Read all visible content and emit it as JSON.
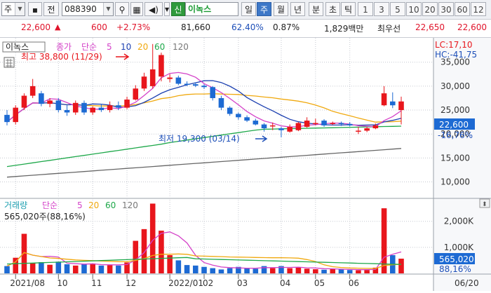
{
  "toolbar": {
    "market": "주",
    "prev_label": "전",
    "code": "088390",
    "signal_badge": "신",
    "stock_name": "이녹스",
    "periods": [
      "일",
      "주",
      "월",
      "년",
      "분",
      "초",
      "틱"
    ],
    "selected_period": "주",
    "intervals": [
      "1",
      "3",
      "5",
      "10",
      "20",
      "30",
      "60",
      "12"
    ]
  },
  "price_row": {
    "price": "22,600",
    "change": "600",
    "change_pct": "+2.73%",
    "volume": "81,660",
    "pct1": "62.40%",
    "pct2": "0.87%",
    "amount": "1,829백만",
    "quote_label": "최우선",
    "ask": "22,650",
    "bid": "22,600"
  },
  "legend": {
    "name": "이녹스",
    "price_label": "종가",
    "ma_label": "단순",
    "ma_periods": [
      "5",
      "10",
      "20",
      "60",
      "120"
    ]
  },
  "volume_legend": {
    "name": "거래량",
    "ma_label": "단순",
    "ma_periods": [
      "5",
      "20",
      "60",
      "120"
    ],
    "current": "565,020주(88,16%)"
  },
  "annotations": {
    "high": "최고 38,800 (11/29)",
    "low": "최저 19,300 (03/14)"
  },
  "right_axis": {
    "lc": "LC:17,10",
    "hc": "HC:-41,75",
    "price_ticks": [
      "35,000",
      "30,000",
      "25,000",
      "20,000",
      "15,000",
      "10,000"
    ],
    "current_price": "22,600",
    "current_pct": "-16,76%",
    "volume_ticks": [
      "2,000K",
      "1,000K"
    ],
    "current_volume": "565,020",
    "current_volume_pct": "88,16%"
  },
  "x_axis": [
    "2021/08",
    "10",
    "11",
    "12",
    "2022/01",
    "02",
    "03",
    "04",
    "05",
    "06",
    "06/20"
  ],
  "colors": {
    "up": "#e8161c",
    "down": "#1d6ad3",
    "ma5": "#d442c8",
    "ma10": "#1b3fb0",
    "ma20": "#f0a90f",
    "ma60": "#1ea84a",
    "ma120": "#666666"
  },
  "chart_data": {
    "type": "candlestick",
    "x": [
      "2021-07-26",
      "2021-08-02",
      "2021-08-09",
      "2021-08-16",
      "2021-08-23",
      "2021-08-30",
      "2021-09-06",
      "2021-09-13",
      "2021-09-20",
      "2021-09-27",
      "2021-10-04",
      "2021-10-11",
      "2021-10-18",
      "2021-10-25",
      "2021-11-01",
      "2021-11-08",
      "2021-11-15",
      "2021-11-22",
      "2021-11-29",
      "2021-12-06",
      "2021-12-13",
      "2021-12-20",
      "2021-12-27",
      "2022-01-03",
      "2022-01-10",
      "2022-01-17",
      "2022-01-24",
      "2022-02-07",
      "2022-02-14",
      "2022-02-21",
      "2022-02-28",
      "2022-03-07",
      "2022-03-14",
      "2022-03-21",
      "2022-03-28",
      "2022-04-04",
      "2022-04-11",
      "2022-04-18",
      "2022-04-25",
      "2022-05-02",
      "2022-05-09",
      "2022-05-16",
      "2022-05-23",
      "2022-05-30",
      "2022-06-06",
      "2022-06-13",
      "2022-06-20"
    ],
    "open": [
      24000,
      22500,
      25500,
      28000,
      28500,
      26300,
      27000,
      25000,
      24500,
      26500,
      24500,
      25500,
      25000,
      26000,
      25500,
      27200,
      29500,
      30000,
      32000,
      31500,
      31800,
      30500,
      30400,
      30100,
      29800,
      27500,
      25500,
      24200,
      23500,
      22800,
      22000,
      21800,
      21200,
      20500,
      20800,
      21500,
      22300,
      22800,
      22300,
      22300,
      22100,
      20500,
      20700,
      21200,
      26000,
      26800,
      25000
    ],
    "close": [
      22500,
      25500,
      28000,
      30000,
      26300,
      27000,
      25000,
      24500,
      26500,
      24500,
      25500,
      25000,
      26000,
      25500,
      27200,
      29500,
      32000,
      33500,
      36500,
      31800,
      30500,
      30400,
      30100,
      29800,
      27500,
      25500,
      24200,
      23500,
      22800,
      22000,
      21200,
      21800,
      20800,
      21500,
      22300,
      22800,
      22300,
      21800,
      22300,
      22100,
      21800,
      20700,
      21200,
      21800,
      28500,
      26000,
      26800
    ],
    "high": [
      25000,
      26000,
      28500,
      31500,
      29000,
      27500,
      27500,
      26000,
      27000,
      27000,
      25800,
      26300,
      26800,
      26800,
      27800,
      30200,
      32800,
      38800,
      37000,
      32500,
      32200,
      31000,
      30800,
      30400,
      30000,
      28000,
      25800,
      24500,
      23900,
      23200,
      22300,
      22400,
      21500,
      22000,
      22500,
      23500,
      23200,
      23100,
      22600,
      22600,
      22500,
      21500,
      21500,
      22200,
      30000,
      28700,
      27800
    ],
    "low": [
      21800,
      22000,
      25000,
      27500,
      25800,
      25600,
      24500,
      23800,
      24000,
      24000,
      24000,
      24600,
      24500,
      25000,
      25200,
      27000,
      29000,
      29500,
      31000,
      30800,
      30200,
      30000,
      29800,
      29400,
      27000,
      25000,
      23800,
      23000,
      22500,
      21800,
      20500,
      20800,
      19300,
      20300,
      20600,
      21300,
      21800,
      21500,
      21900,
      21700,
      21600,
      20000,
      20400,
      21000,
      25800,
      25400,
      22000
    ],
    "volume": [
      280,
      600,
      1520,
      400,
      430,
      330,
      450,
      350,
      300,
      350,
      380,
      300,
      310,
      300,
      420,
      1250,
      1700,
      2680,
      1640,
      700,
      500,
      320,
      300,
      250,
      200,
      150,
      200,
      250,
      200,
      180,
      280,
      200,
      280,
      200,
      220,
      180,
      160,
      140,
      180,
      150,
      130,
      120,
      130,
      220,
      2500,
      700,
      565
    ],
    "ylim": [
      7000,
      39500
    ],
    "volume_ylim": [
      0,
      2800
    ]
  }
}
